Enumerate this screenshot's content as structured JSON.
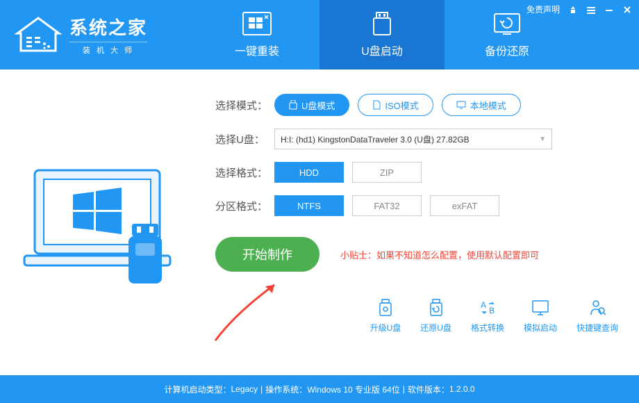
{
  "header": {
    "logo_title": "系统之家",
    "logo_sub": "装 机 大 师",
    "disclaimer": "免责声明"
  },
  "tabs": [
    {
      "label": "一键重装"
    },
    {
      "label": "U盘启动"
    },
    {
      "label": "备份还原"
    }
  ],
  "mode": {
    "label": "选择模式：",
    "options": [
      {
        "label": "U盘模式",
        "active": true
      },
      {
        "label": "ISO模式",
        "active": false
      },
      {
        "label": "本地模式",
        "active": false
      }
    ]
  },
  "usb": {
    "label": "选择U盘：",
    "value": "H:I: (hd1) KingstonDataTraveler 3.0 (U盘) 27.82GB"
  },
  "format": {
    "label": "选择格式：",
    "options": [
      {
        "label": "HDD",
        "active": true
      },
      {
        "label": "ZIP",
        "active": false
      }
    ]
  },
  "partition": {
    "label": "分区格式：",
    "options": [
      {
        "label": "NTFS",
        "active": true
      },
      {
        "label": "FAT32",
        "active": false
      },
      {
        "label": "exFAT",
        "active": false
      }
    ]
  },
  "start_button": "开始制作",
  "tip": "小贴士：如果不知道怎么配置，使用默认配置即可",
  "quick_actions": [
    {
      "label": "升级U盘"
    },
    {
      "label": "还原U盘"
    },
    {
      "label": "格式转换"
    },
    {
      "label": "模拟启动"
    },
    {
      "label": "快捷键查询"
    }
  ],
  "footer": {
    "boot_type_label": "计算机启动类型：",
    "boot_type": "Legacy",
    "os_label": "操作系统：",
    "os": "Windows 10 专业版 64位",
    "version_label": "软件版本：",
    "version": "1.2.0.0"
  }
}
